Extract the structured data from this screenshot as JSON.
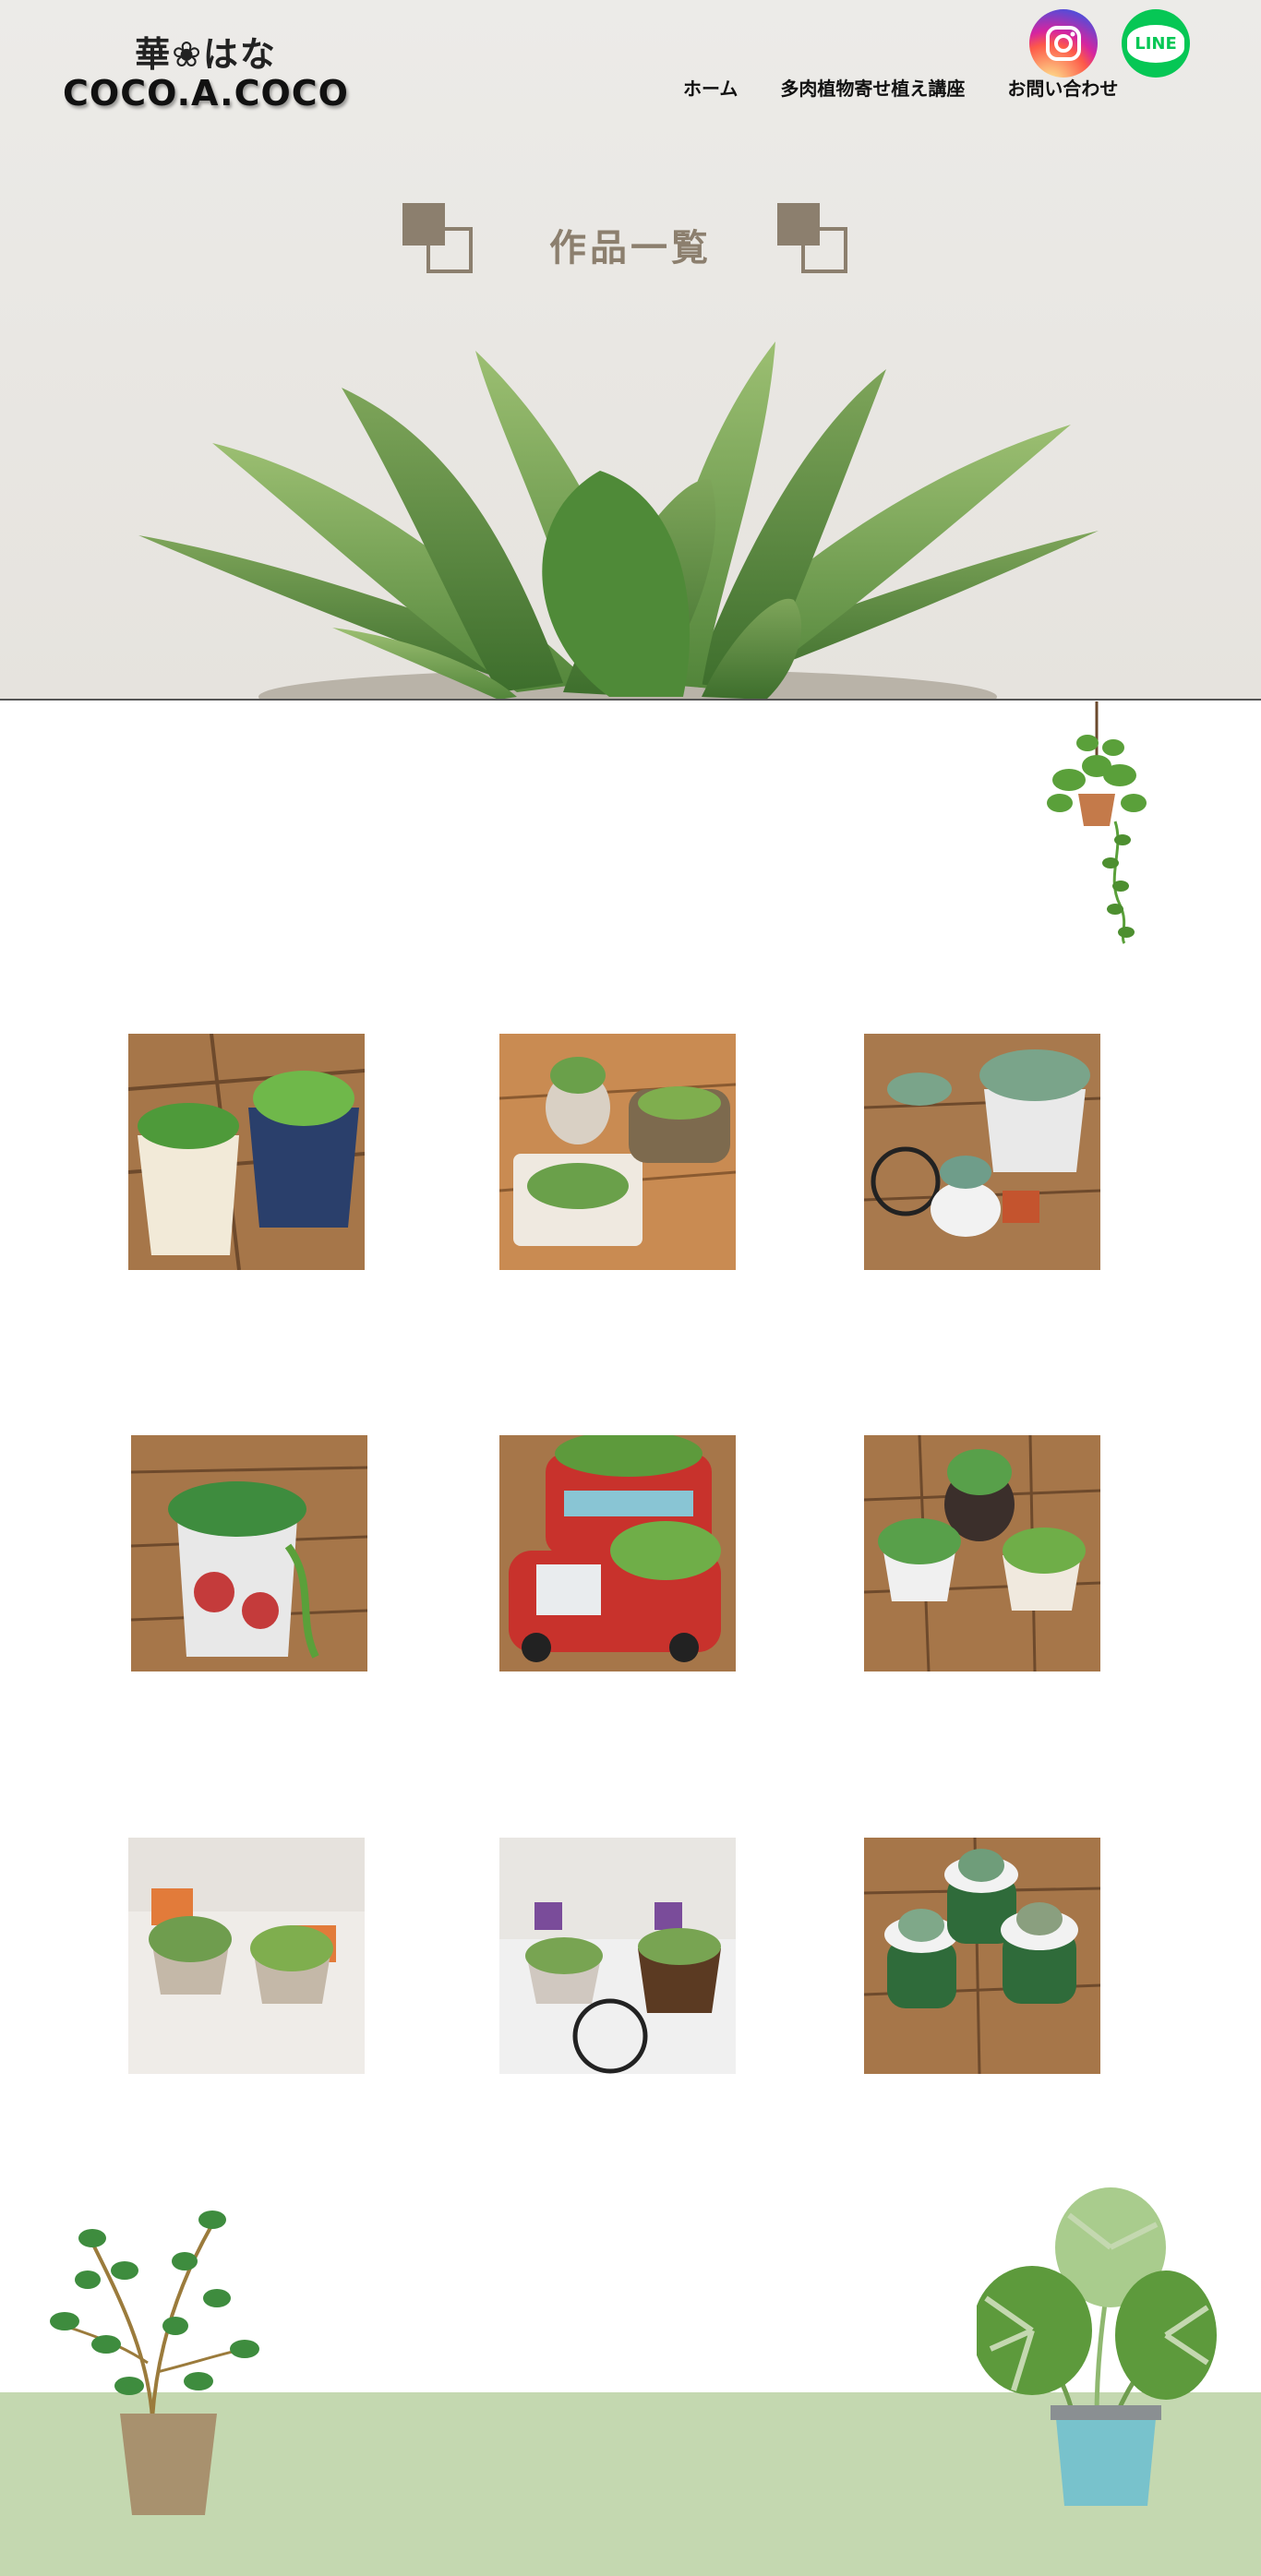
{
  "header": {
    "logo_line1": "華❀はな",
    "logo_line2": "COCO.A.COCO",
    "nav": [
      "ホーム",
      "多肉植物寄せ植え講座",
      "お問い合わせ"
    ],
    "social": {
      "instagram_icon": "instagram-icon",
      "line_label": "LINE"
    }
  },
  "hero": {
    "title": "作品一覧"
  },
  "gallery": {
    "items": [
      {
        "name": "pots-garden-pair",
        "colors": [
          "#f2ead8",
          "#2a3f6b",
          "#4e9a3a",
          "#8a5a3c"
        ]
      },
      {
        "name": "hedgehog-book-log",
        "colors": [
          "#efe9e0",
          "#7d6a4e",
          "#6aa04a",
          "#c98b52"
        ]
      },
      {
        "name": "bicycle-pig-set",
        "colors": [
          "#e9e9e9",
          "#222",
          "#7aa48a",
          "#a8794d"
        ]
      },
      {
        "name": "tin-can-rose",
        "colors": [
          "#e8e8e8",
          "#c43b3b",
          "#3e8c3e",
          "#a67649"
        ]
      },
      {
        "name": "red-bus-truck",
        "colors": [
          "#c8322c",
          "#89c5d4",
          "#5d9a3c",
          "#a67649"
        ]
      },
      {
        "name": "wheelbarrow-basket",
        "colors": [
          "#3b2f2b",
          "#f0f0f0",
          "#58a04a",
          "#a67649"
        ]
      },
      {
        "name": "two-baskets",
        "colors": [
          "#efece8",
          "#e27b3a",
          "#6f9d4e",
          "#c4b8a8"
        ]
      },
      {
        "name": "bicycle-white-chair",
        "colors": [
          "#f0f0f0",
          "#222",
          "#78a452",
          "#d0c8c0"
        ]
      },
      {
        "name": "green-cups-trio",
        "colors": [
          "#f2f2f2",
          "#2f6b3a",
          "#7fa889",
          "#a67649"
        ]
      }
    ]
  },
  "colors": {
    "accent": "#8c7f6e",
    "ground": "#c4d8b0",
    "hero_bg": "#e9e7e4"
  }
}
